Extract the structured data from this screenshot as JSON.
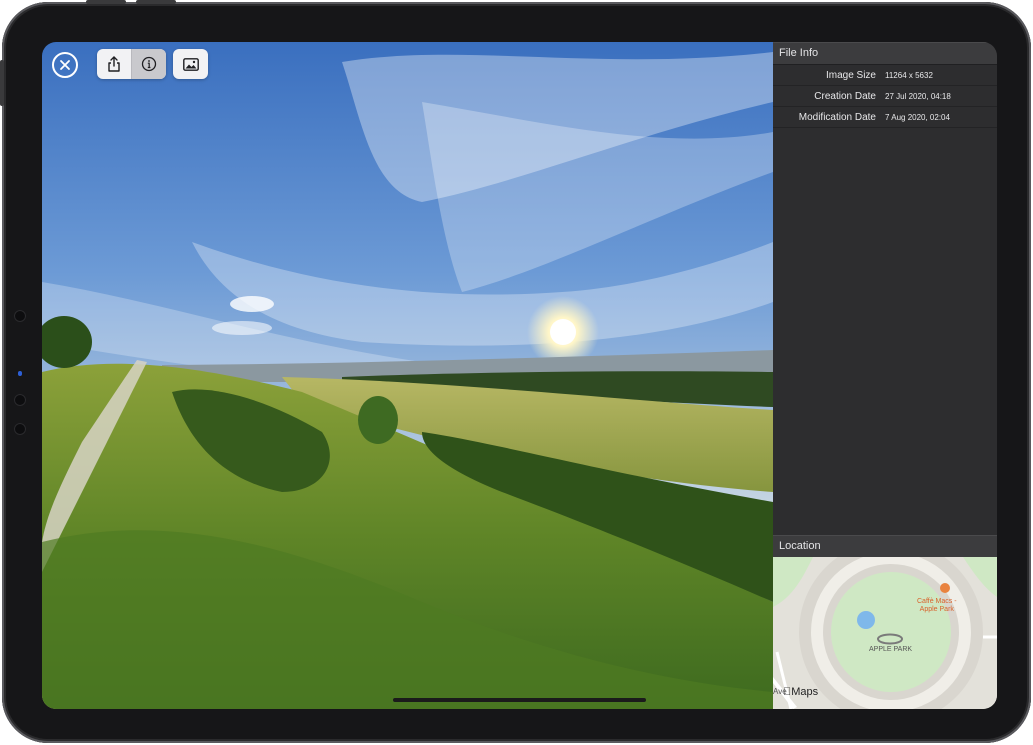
{
  "toolbar": {
    "close_icon": "close-circle-icon",
    "share_icon": "share-icon",
    "info_icon": "info-icon",
    "image_icon": "image-icon"
  },
  "file_info": {
    "title": "File Info",
    "rows": [
      {
        "label": "Image Size",
        "value": "11264 x 5632"
      },
      {
        "label": "Creation Date",
        "value": "27 Jul 2020, 04:18"
      },
      {
        "label": "Modification Date",
        "value": "7 Aug 2020, 02:04"
      }
    ]
  },
  "location": {
    "title": "Location",
    "map": {
      "place_label": "APPLE PARK",
      "cafe_label_line1": "Caffè Macs -",
      "cafe_label_line2": "Apple Park",
      "street_fragment": "Ave",
      "brand": "Maps"
    }
  },
  "colors": {
    "panel_bg": "#2d2d2f",
    "header_bg": "#3c3c3e",
    "accent_cafe": "#d9622b"
  }
}
